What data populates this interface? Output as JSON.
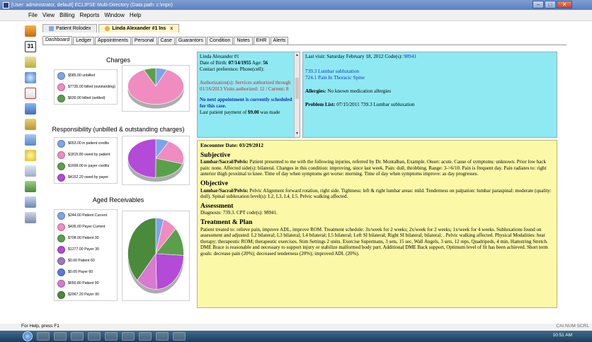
{
  "window": {
    "title": "[User: administrator, default]  ECLIPSE Multi-Directory (Data path: c:\\mpn)",
    "buttons": {
      "minimize": "–",
      "maximize": "□",
      "close": "✕"
    }
  },
  "menu": [
    "File",
    "View",
    "Billing",
    "Reports",
    "Window",
    "Help"
  ],
  "left_toolbar": [
    "app-logo-icon",
    "calendar-icon",
    "notes-icon",
    "search-icon",
    "document-x-icon",
    "calendar-grid-icon",
    "folder-icon",
    "chart-icon",
    "lightbulb-icon",
    "page-icon",
    "money-icon",
    "exit-icon",
    "pen-icon"
  ],
  "calendar_day": "31",
  "doc_tabs": [
    {
      "label": "Patient Rolodex"
    },
    {
      "label": "Linda Alexander #1 Ins",
      "close": "x"
    }
  ],
  "sub_tabs": [
    "Dashboard",
    "Ledger",
    "Appointments",
    "Personal",
    "Case",
    "Guarantors",
    "Condition",
    "Notes",
    "EHR",
    "Alerts"
  ],
  "charges": {
    "title": "Charges",
    "legend": [
      {
        "label": "$585.00 unbilled",
        "color": "#7da4e8"
      },
      {
        "label": "$7735.00 billed (outstanding)",
        "color": "#f08cc0"
      },
      {
        "label": "$630.00 billed (settled)",
        "color": "#5aa04a"
      }
    ],
    "values": [
      585,
      7735,
      630
    ]
  },
  "responsibility": {
    "title": "Responsibility (unbilled & outstanding charges)",
    "legend": [
      {
        "label": "$653.00 in patient credits",
        "color": "#7da4e8"
      },
      {
        "label": "$1815.80 owed by patient",
        "color": "#f08cc0"
      },
      {
        "label": "$1699.00 in payer credits",
        "color": "#5aa04a"
      },
      {
        "label": "$4152.20 owed by payer",
        "color": "#b44ad8"
      }
    ],
    "values": [
      653,
      1815.8,
      1699,
      4152.2
    ]
  },
  "aged": {
    "title": "Aged Receivables",
    "legend": [
      {
        "label": "$244.00 Patient Current",
        "color": "#7da4e8"
      },
      {
        "label": "$436.00 Payer Current",
        "color": "#f08cc0"
      },
      {
        "label": "$708.00 Patient 30",
        "color": "#5aa04a"
      },
      {
        "label": "$1277.00 Payer 30",
        "color": "#b44ad8"
      },
      {
        "label": "$0.00 Patient 60",
        "color": "#9a7ab8"
      },
      {
        "label": "$0.00 Payer 60",
        "color": "#5a7ad8"
      },
      {
        "label": "$650.80 Patient 90",
        "color": "#d87ad0"
      },
      {
        "label": "$2067.20 Payer 90",
        "color": "#4a8a3a"
      }
    ],
    "values": [
      244,
      436,
      708,
      1277,
      0,
      0,
      650.8,
      2067.2
    ]
  },
  "patient_info": {
    "name": "Linda Alexander #1",
    "dob_label": "Date of Birth:",
    "dob": "07/14/1955",
    "age_label": "Age:",
    "age": "56",
    "contact": "Contact preference: Phone(cell):",
    "auth": "Authorization(s): Services authorized through 01/16/2013 Visits authorized: 12 / Current: 8",
    "no_appt": "No next appointment is currently scheduled for this case.",
    "last_payment_label": "Last patient payment of",
    "last_payment": "$9.00",
    "last_payment_tail": "was made"
  },
  "visit_info": {
    "last_visit": "Last visit: Saturday February 18, 2012 Code(s):",
    "last_visit_code": "98941",
    "codes": [
      "739.3 Lumbar subluxation",
      "724.1 Pain In Thoracic Spine"
    ],
    "allergies_label": "Allergies:",
    "allergies": "No known medication allergies",
    "problems_label": "Problem List:",
    "problems": "07/15/2011 739.3 Lumbar subluxation"
  },
  "encounter": {
    "date": "Encounter Date: 03/29/2012",
    "subjective_title": "Subjective",
    "subjective_lead": "Lumbar/Sacral/Pelvis:",
    "subjective_text": "Patient presented to me with the following injuries, referred by Dr. Montalban, Example. Onset: acute. Cause of symptoms: unknown. Prior low back pain: none. Affected side(s): bilateral. Changes in this condition: improving, since last week. Pain: dull, throbbing. Range: 3->6/10. Pain is frequent day. Pain radiates to: right anterior thigh proximal to knee. Time of day when symptoms get worse: morning. Time of day when symptoms improve: as day progresses.",
    "objective_title": "Objective",
    "objective_lead": "Lumbar/Sacral/Pelvis:",
    "objective_text": "Pelvic Alignment forward rotation, right side. Tightness: left & right lumbar areas: mild. Tenderness on palpation: lumbar paraspinal: moderate (quality: dull). Spinal subluxation level(s): L2, L3, L4, L5. Pelvic walking affected.",
    "assessment_title": "Assessment",
    "assessment_text": "Diagnosis: 739.3. CPT code(s): 98941.",
    "treatment_title": "Treatment & Plan",
    "treatment_text": "Patient treated to: relieve pain, improve ADL, improve ROM. Treatment schedule: 3x/week for 2 weeks; 2x/week for 2 weeks; 1x/week for 4 weeks. Subluxations found on assessment and adjusted: L2 bilateral; L3 bilateral; L4 bilateral; L5 bilateral; Left SI bilateral; Right SI bilateral; bilateral; . Pelvic walking affected. Physical Modalities: heat therapy; therapeutic ROM; therapeutic exercises. Stim Settings 2 units. Exercise Supermans, 3 sets, 15 sec, Wall Angels, 3 sets, 12 reps, Quadripeds, 4 min, Hamstring Stretch. DME Brace is reasonable and necessary to support injury or stabilize malformed body part. Additional DME Back support, Optimum level of fit has been achieved. Short term goals: decrease pain (20%); decreased tenderness (20%); improved ADL (20%)."
  },
  "status": {
    "left": "For Help, press F1",
    "right": "CAI NUM SCRL"
  },
  "taskbar": {
    "time": "10:51 AM"
  }
}
